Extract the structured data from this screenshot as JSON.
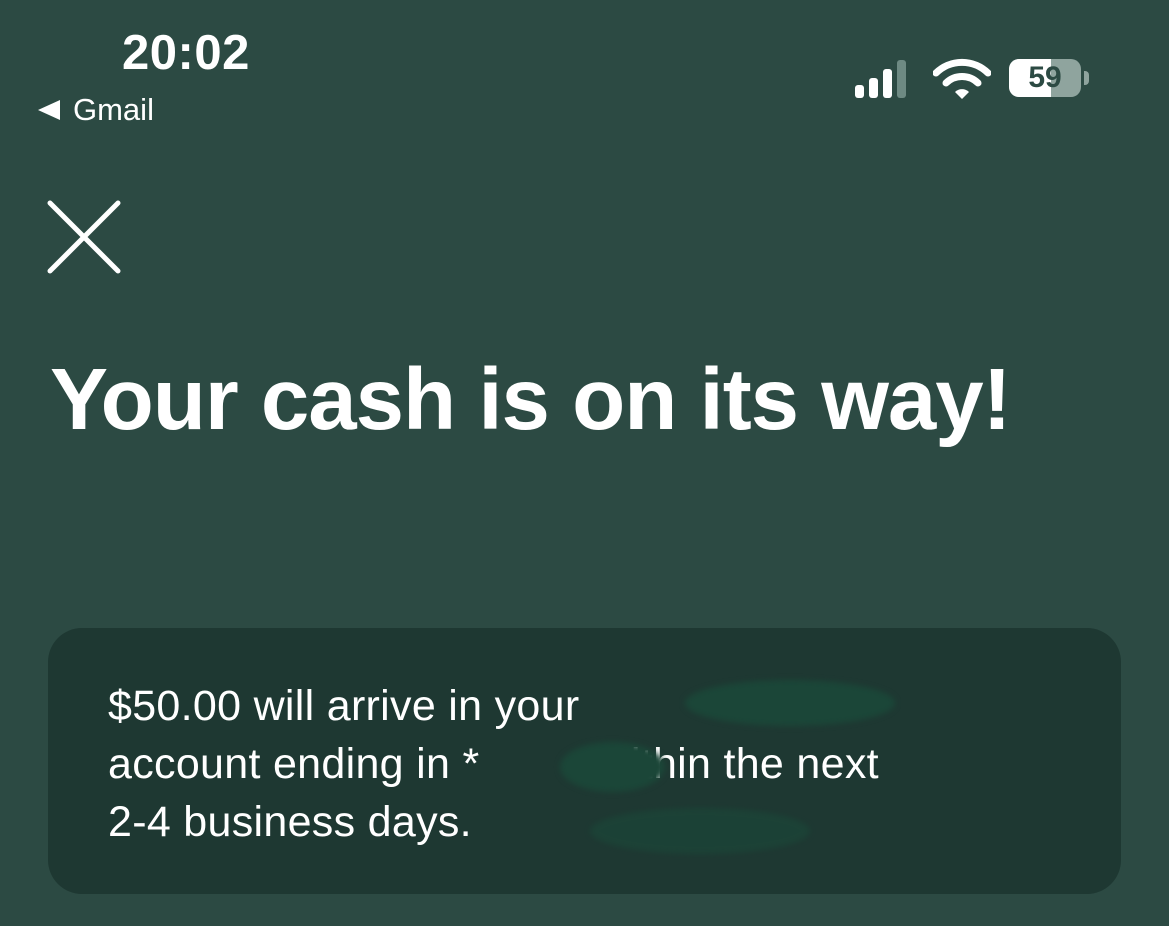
{
  "status_bar": {
    "time": "20:02",
    "back_label": "Gmail",
    "signal_bars_active": 3,
    "signal_bars_total": 4,
    "battery_percent": 59,
    "battery_label": "59"
  },
  "header": {
    "close_icon": "close-icon"
  },
  "main": {
    "headline": "Your cash is on its way!"
  },
  "info_card": {
    "message_line_1": "$50.00 will arrive in your",
    "message_line_2": "account ending in *",
    "message_line_2_cont": "within the next",
    "message_line_3": "2-4 business days."
  },
  "colors": {
    "background": "#2c4a43",
    "card_background": "#1e3832",
    "text": "#ffffff",
    "redaction": "#1b4638"
  },
  "icons": {
    "back": "back-arrow-icon",
    "signal": "cellular-signal-icon",
    "wifi": "wifi-icon",
    "battery": "battery-icon",
    "close": "close-icon"
  }
}
